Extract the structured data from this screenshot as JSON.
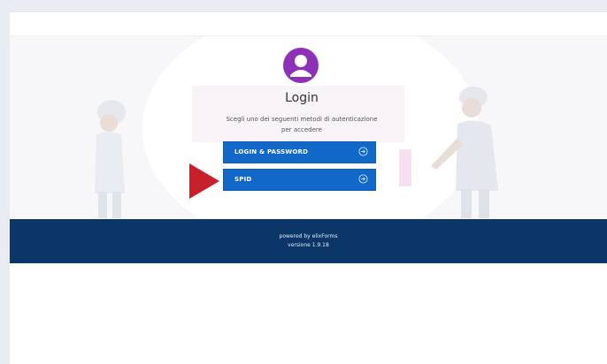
{
  "login": {
    "title": "Login",
    "subtitle_line1": "Scegli uno dei seguenti metodi di autenticazione",
    "subtitle_line2": "per accedere"
  },
  "buttons": [
    {
      "label": "LOGIN & PASSWORD",
      "icon": "arrow-right-circle-icon"
    },
    {
      "label": "SPID",
      "icon": "arrow-right-circle-icon"
    }
  ],
  "footer": {
    "powered_by": "powered by elixForms",
    "version": "versione 1.9.18"
  },
  "colors": {
    "avatar": "#8e30b8",
    "button": "#1168c9",
    "footer": "#0d3668",
    "pointer_arrow": "#c8202a"
  }
}
